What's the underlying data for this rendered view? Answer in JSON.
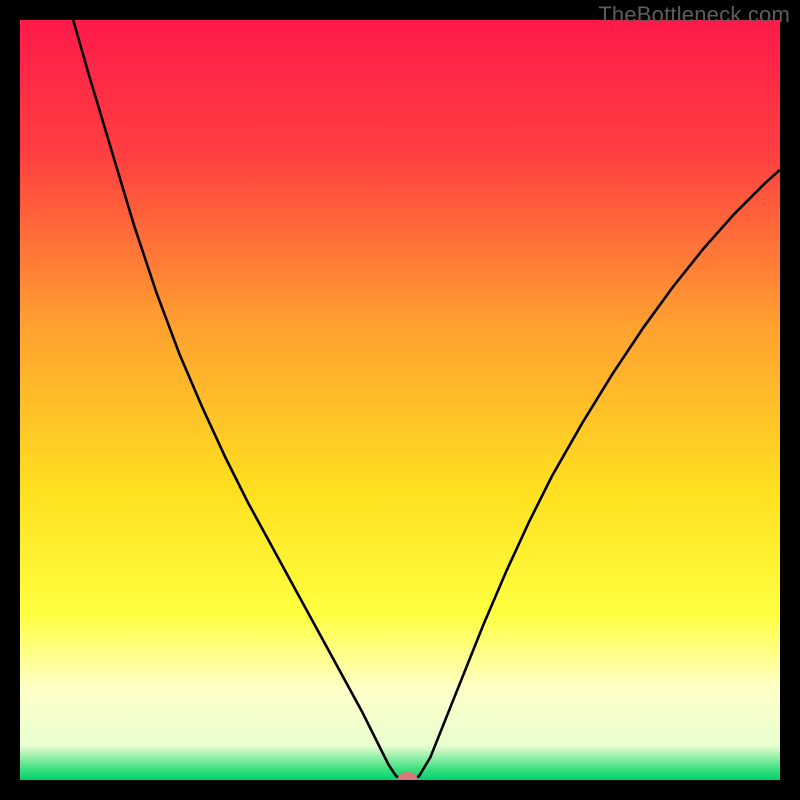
{
  "watermark": "TheBottleneck.com",
  "chart_data": {
    "type": "line",
    "title": "",
    "xlabel": "",
    "ylabel": "",
    "xlim": [
      0,
      100
    ],
    "ylim": [
      0,
      100
    ],
    "gradient_stops": [
      {
        "offset": 0.0,
        "color": "#ff1a4a"
      },
      {
        "offset": 0.18,
        "color": "#ff4040"
      },
      {
        "offset": 0.4,
        "color": "#ffa030"
      },
      {
        "offset": 0.62,
        "color": "#ffe020"
      },
      {
        "offset": 0.78,
        "color": "#ffff40"
      },
      {
        "offset": 0.88,
        "color": "#ffffc8"
      },
      {
        "offset": 0.955,
        "color": "#e8ffd0"
      },
      {
        "offset": 0.985,
        "color": "#40e080"
      },
      {
        "offset": 1.0,
        "color": "#00d070"
      }
    ],
    "curve_points": [
      {
        "x": 7.0,
        "y": 100.0
      },
      {
        "x": 9.0,
        "y": 93.0
      },
      {
        "x": 12.0,
        "y": 83.0
      },
      {
        "x": 15.0,
        "y": 73.0
      },
      {
        "x": 18.0,
        "y": 64.0
      },
      {
        "x": 21.0,
        "y": 56.0
      },
      {
        "x": 24.0,
        "y": 49.0
      },
      {
        "x": 27.0,
        "y": 42.5
      },
      {
        "x": 30.0,
        "y": 36.5
      },
      {
        "x": 33.0,
        "y": 31.0
      },
      {
        "x": 36.0,
        "y": 25.5
      },
      {
        "x": 39.0,
        "y": 20.0
      },
      {
        "x": 42.0,
        "y": 14.5
      },
      {
        "x": 45.0,
        "y": 9.0
      },
      {
        "x": 47.0,
        "y": 5.0
      },
      {
        "x": 48.5,
        "y": 2.0
      },
      {
        "x": 49.5,
        "y": 0.5
      },
      {
        "x": 50.5,
        "y": 0.0
      },
      {
        "x": 51.5,
        "y": 0.0
      },
      {
        "x": 52.5,
        "y": 0.5
      },
      {
        "x": 54.0,
        "y": 3.0
      },
      {
        "x": 56.0,
        "y": 8.0
      },
      {
        "x": 58.0,
        "y": 13.0
      },
      {
        "x": 61.0,
        "y": 20.5
      },
      {
        "x": 64.0,
        "y": 27.5
      },
      {
        "x": 67.0,
        "y": 34.0
      },
      {
        "x": 70.0,
        "y": 40.0
      },
      {
        "x": 74.0,
        "y": 47.0
      },
      {
        "x": 78.0,
        "y": 53.5
      },
      {
        "x": 82.0,
        "y": 59.5
      },
      {
        "x": 86.0,
        "y": 65.0
      },
      {
        "x": 90.0,
        "y": 70.0
      },
      {
        "x": 94.0,
        "y": 74.5
      },
      {
        "x": 98.0,
        "y": 78.5
      },
      {
        "x": 100.0,
        "y": 80.3
      }
    ],
    "marker": {
      "x": 51.0,
      "y": 0.15,
      "rx": 1.3,
      "ry": 0.9,
      "color": "#d87878"
    }
  }
}
